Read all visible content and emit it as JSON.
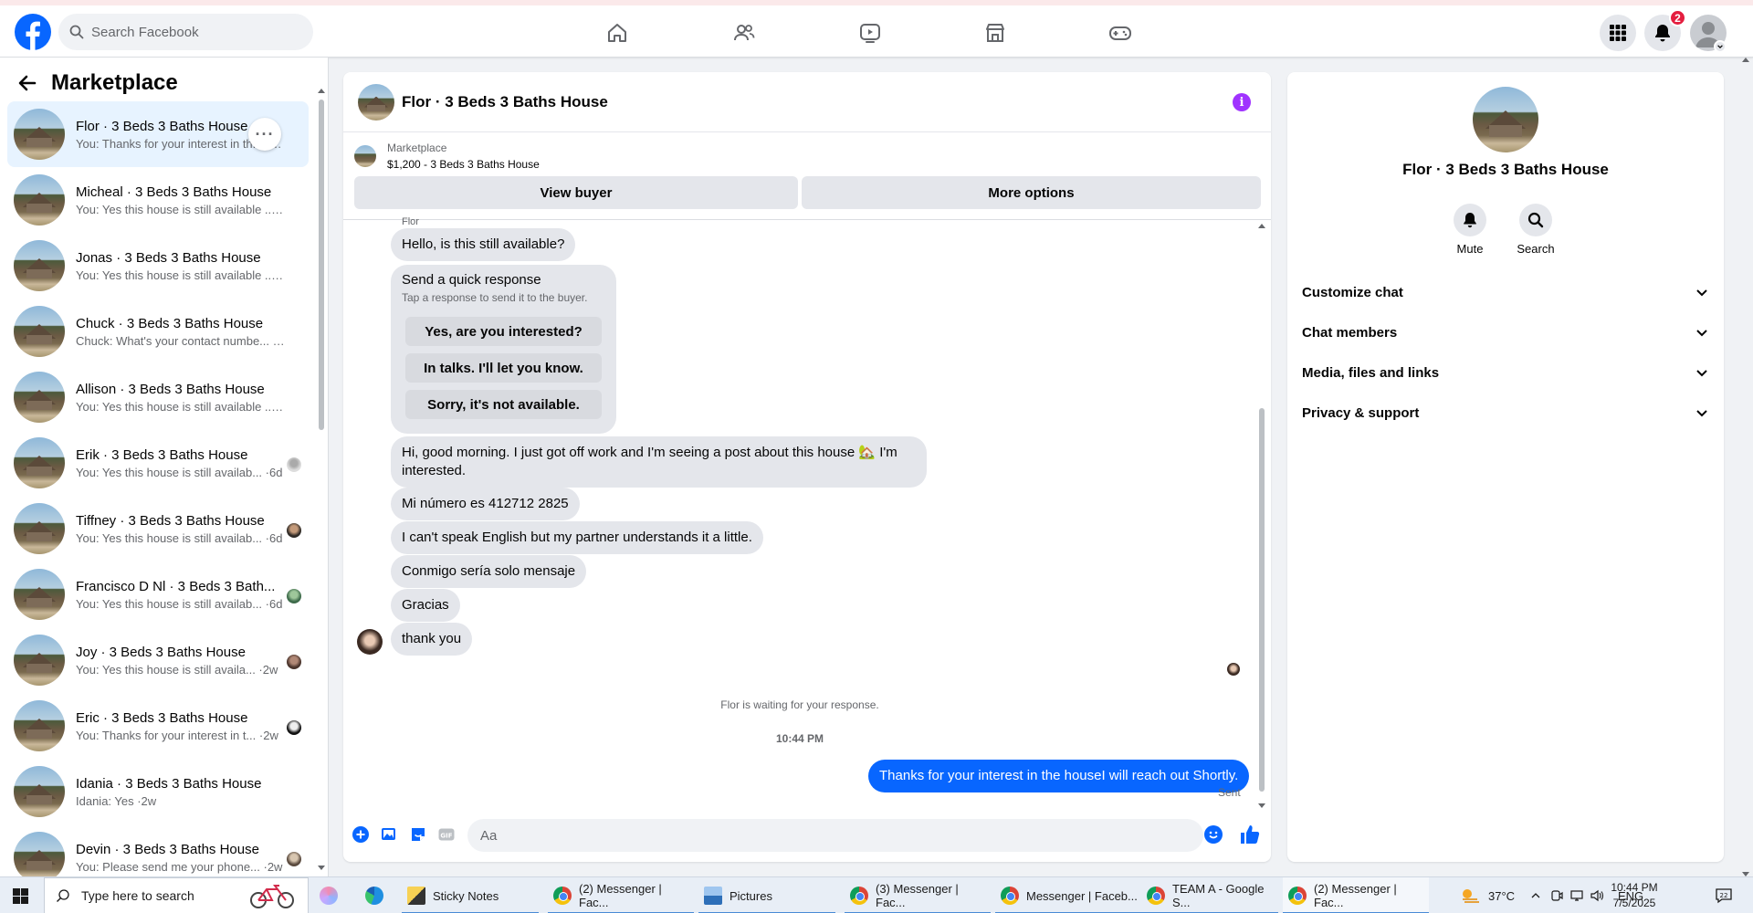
{
  "topnav": {
    "search_placeholder": "Search Facebook",
    "notification_count": "2",
    "icons": [
      "home-icon",
      "friends-icon",
      "video-icon",
      "marketplace-icon",
      "gaming-icon",
      "menu-grid-icon",
      "bell-icon",
      "profile-icon"
    ]
  },
  "sidebar": {
    "title": "Marketplace",
    "conversations": [
      {
        "name": "Flor · 3 Beds 3 Baths House",
        "snippet": "You: Thanks for your interest in th... ·3m",
        "active": true
      },
      {
        "name": "Micheal · 3 Beds 3 Baths House",
        "snippet": "You: Yes this house is still available ... ·3m"
      },
      {
        "name": "Jonas · 3 Beds 3 Baths House",
        "snippet": "You: Yes this house is still available ... ·4m"
      },
      {
        "name": "Chuck · 3 Beds 3 Baths House",
        "snippet": "Chuck: What's your contact numbe... ·5d"
      },
      {
        "name": "Allison · 3 Beds 3 Baths House",
        "snippet": "You: Yes this house is still available ... ·6d"
      },
      {
        "name": "Erik · 3 Beds 3 Baths House",
        "snippet": "You: Yes this house is still availab... ·6d"
      },
      {
        "name": "Tiffney · 3 Beds 3 Baths House",
        "snippet": "You: Yes this house is still availab... ·6d"
      },
      {
        "name": "Francisco D Nl · 3 Beds 3 Bath...",
        "snippet": "You: Yes this house is still availab... ·6d"
      },
      {
        "name": "Joy · 3 Beds 3 Baths House",
        "snippet": "You: Yes this house is still availa... ·2w"
      },
      {
        "name": "Eric · 3 Beds 3 Baths House",
        "snippet": "You: Thanks for your interest in t... ·2w"
      },
      {
        "name": "Idania · 3 Beds 3 Baths House",
        "snippet": "Idania: Yes ·2w"
      },
      {
        "name": "Devin · 3 Beds 3 Baths House",
        "snippet": "You: Please send me your phone... ·2w"
      }
    ]
  },
  "chat": {
    "title": "Flor · 3 Beds 3 Baths House",
    "listing_label": "Marketplace",
    "listing_price_title": "$1,200 - 3 Beds 3 Baths House",
    "view_buyer": "View buyer",
    "more_options": "More options",
    "sender_name_cut": "Flor",
    "quick_title": "Send a quick response",
    "quick_subtitle": "Tap a response to send it to the buyer.",
    "quick_options": [
      "Yes, are you interested?",
      "In talks. I'll let you know.",
      "Sorry, it's not available."
    ],
    "incoming": [
      "Hello, is this still available?",
      "Hi, good morning. I just got off work and I'm seeing a post about this house 🏡 I'm interested.",
      "Mi número es 412712 2825",
      "I can't speak English but my partner understands it a little.",
      "Conmigo sería solo mensaje",
      "Gracias",
      "thank you"
    ],
    "waiting": "Flor is waiting for your response.",
    "time": "10:44 PM",
    "outgoing": "Thanks for your interest in the houseI will reach out Shortly.",
    "sent_status": "Sent",
    "composer_placeholder": "Aa",
    "colors": {
      "accent": "#0866ff",
      "info": "#a033ff"
    }
  },
  "right_panel": {
    "name": "Flor · 3 Beds 3 Baths House",
    "mute": "Mute",
    "search": "Search",
    "sections": [
      "Customize chat",
      "Chat members",
      "Media, files and links",
      "Privacy & support"
    ]
  },
  "taskbar": {
    "search_placeholder": "Type here to search",
    "apps": [
      {
        "label": "Sticky Notes"
      },
      {
        "label": "(2) Messenger | Fac..."
      },
      {
        "label": "Pictures"
      },
      {
        "label": "(3) Messenger | Fac..."
      },
      {
        "label": "Messenger | Faceb..."
      },
      {
        "label": "TEAM A - Google S..."
      },
      {
        "label": "(2) Messenger | Fac..."
      }
    ],
    "weather": "37°C",
    "language": "ENG",
    "time": "10:44 PM",
    "date": "7/5/2025"
  }
}
